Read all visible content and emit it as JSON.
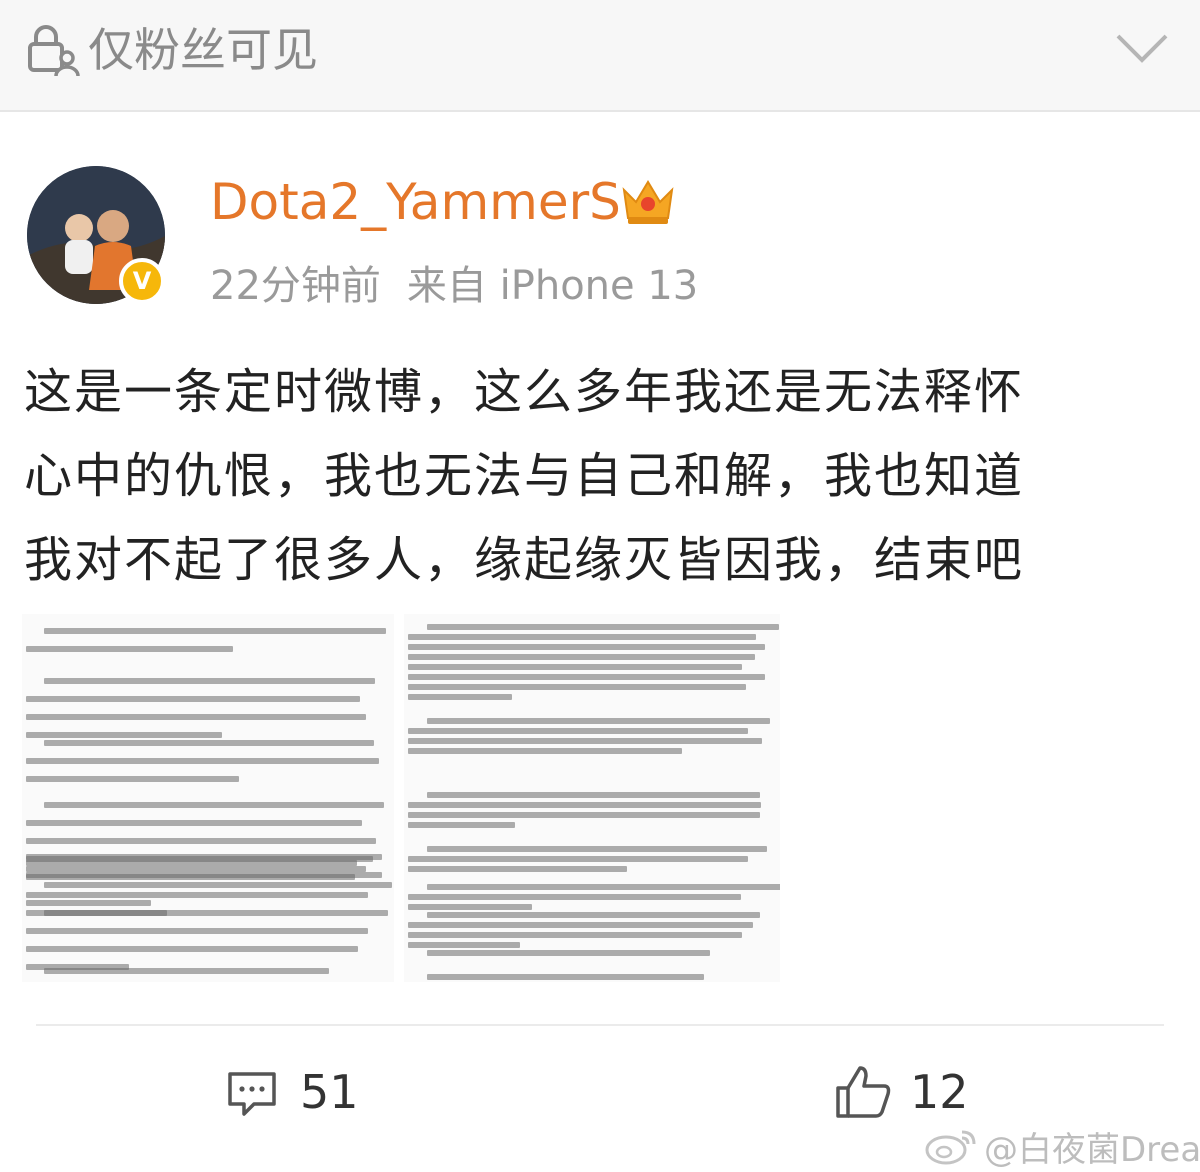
{
  "privacy": {
    "label": "仅粉丝可见",
    "icon": "lock-people-icon"
  },
  "author": {
    "name": "Dota2_YammerS",
    "time": "22分钟前",
    "source": "来自 iPhone 13",
    "badge": "V",
    "name_color": "#e5772a",
    "badge_color": "#f6b70a"
  },
  "post": {
    "lines": [
      "这是一条定时微博，这么多年我还是无法释怀",
      "心中的仇恨，我也无法与自己和解，我也知道",
      "我对不起了很多人，缘起缘灭皆因我，结束吧"
    ]
  },
  "actions": {
    "comment_count": "51",
    "like_count": "12"
  },
  "watermark": {
    "text": "@白夜菌Dream"
  }
}
